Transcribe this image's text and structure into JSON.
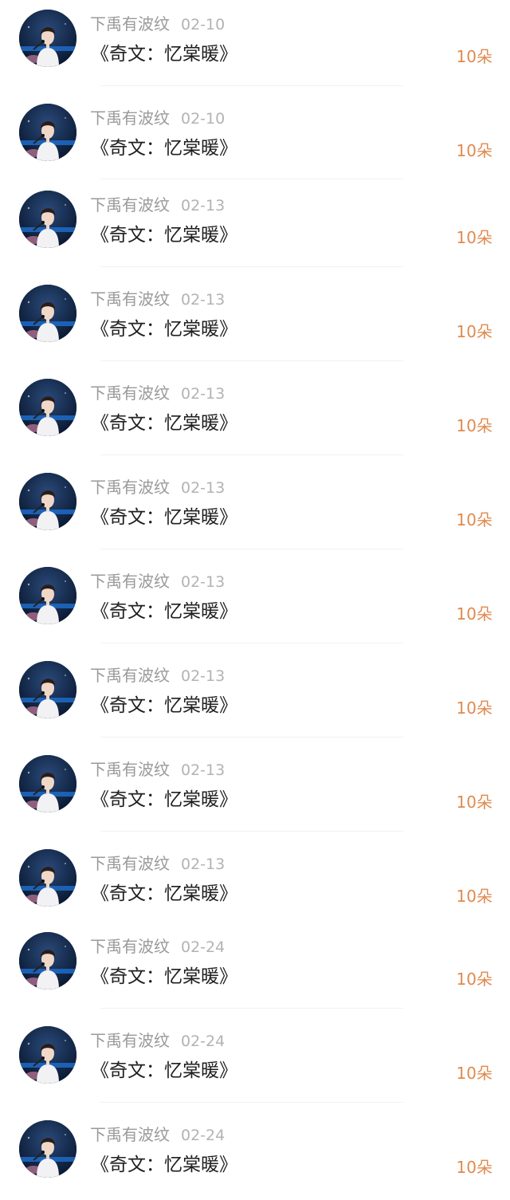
{
  "colors": {
    "username": "#9a9a9a",
    "date": "#b3b3b3",
    "title": "#1f1f1f",
    "gift": "#e08a4f",
    "divider": "#f1f1f1"
  },
  "avatar_icon": "user-avatar-photo",
  "items": [
    {
      "user": "下禹有波纹",
      "date": "02-10",
      "title": "《奇文：忆棠暖》",
      "gift": "10朵"
    },
    {
      "user": "下禹有波纹",
      "date": "02-10",
      "title": "《奇文：忆棠暖》",
      "gift": "10朵"
    },
    {
      "user": "下禹有波纹",
      "date": "02-13",
      "title": "《奇文：忆棠暖》",
      "gift": "10朵"
    },
    {
      "user": "下禹有波纹",
      "date": "02-13",
      "title": "《奇文：忆棠暖》",
      "gift": "10朵"
    },
    {
      "user": "下禹有波纹",
      "date": "02-13",
      "title": "《奇文：忆棠暖》",
      "gift": "10朵"
    },
    {
      "user": "下禹有波纹",
      "date": "02-13",
      "title": "《奇文：忆棠暖》",
      "gift": "10朵"
    },
    {
      "user": "下禹有波纹",
      "date": "02-13",
      "title": "《奇文：忆棠暖》",
      "gift": "10朵"
    },
    {
      "user": "下禹有波纹",
      "date": "02-13",
      "title": "《奇文：忆棠暖》",
      "gift": "10朵"
    },
    {
      "user": "下禹有波纹",
      "date": "02-13",
      "title": "《奇文：忆棠暖》",
      "gift": "10朵"
    },
    {
      "user": "下禹有波纹",
      "date": "02-13",
      "title": "《奇文：忆棠暖》",
      "gift": "10朵"
    },
    {
      "user": "下禹有波纹",
      "date": "02-24",
      "title": "《奇文：忆棠暖》",
      "gift": "10朵"
    },
    {
      "user": "下禹有波纹",
      "date": "02-24",
      "title": "《奇文：忆棠暖》",
      "gift": "10朵"
    },
    {
      "user": "下禹有波纹",
      "date": "02-24",
      "title": "《奇文：忆棠暖》",
      "gift": "10朵"
    }
  ]
}
